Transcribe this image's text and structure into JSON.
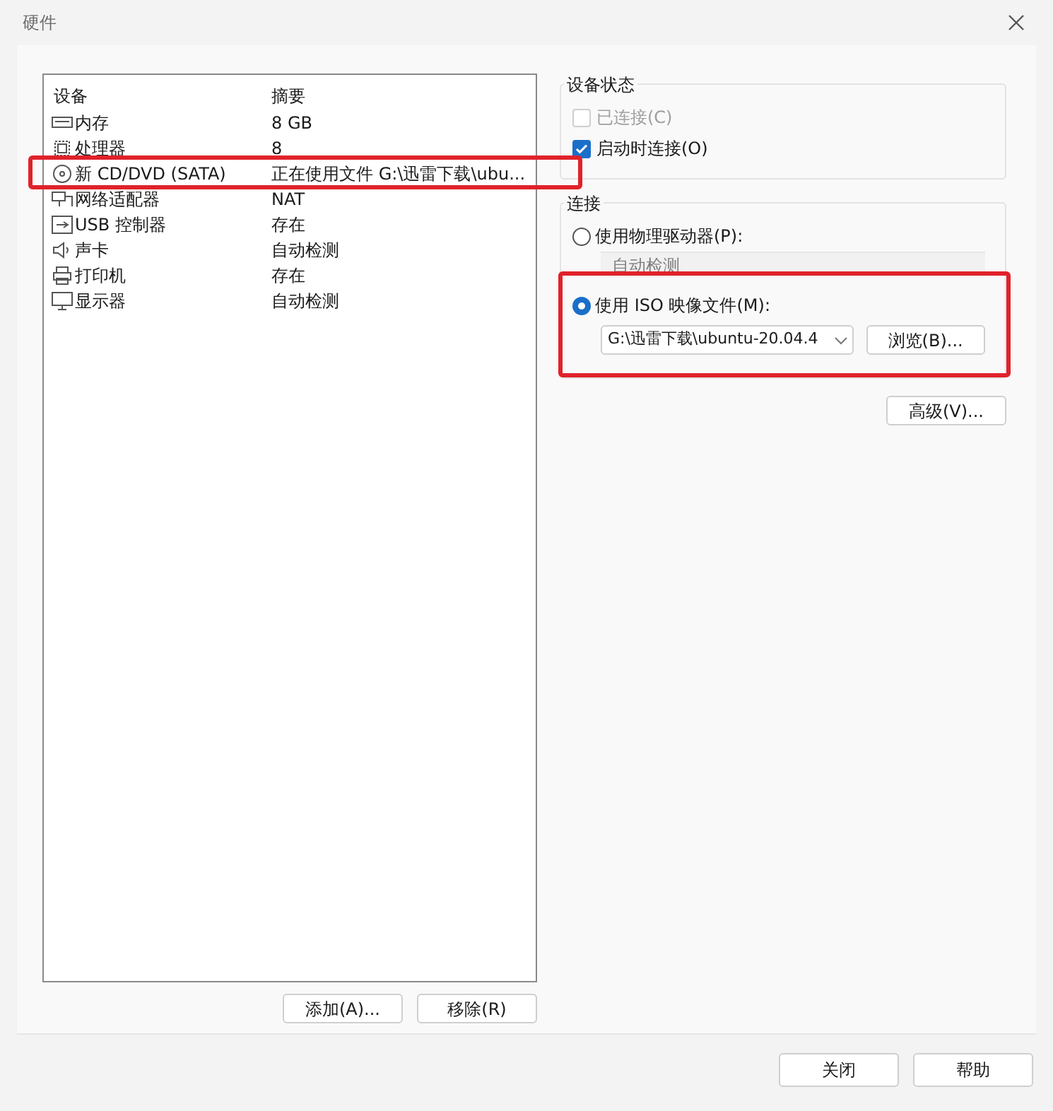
{
  "window": {
    "title": "硬件"
  },
  "device_table": {
    "columns": [
      "设备",
      "摘要"
    ],
    "rows": [
      {
        "device": "内存",
        "summary": "8 GB"
      },
      {
        "device": "处理器",
        "summary": "8"
      },
      {
        "device": "新 CD/DVD (SATA)",
        "summary": "正在使用文件 G:\\迅雷下载\\ubu..."
      },
      {
        "device": "网络适配器",
        "summary": "NAT"
      },
      {
        "device": "USB 控制器",
        "summary": "存在"
      },
      {
        "device": "声卡",
        "summary": "自动检测"
      },
      {
        "device": "打印机",
        "summary": "存在"
      },
      {
        "device": "显示器",
        "summary": "自动检测"
      }
    ]
  },
  "list_buttons": [
    "添加(A)...",
    "移除(R)"
  ],
  "device_status": {
    "title": "设备状态",
    "options": [
      {
        "label": "已连接(C)",
        "checked": false,
        "disabled": true
      },
      {
        "label": "启动时连接(O)",
        "checked": true,
        "disabled": false
      }
    ]
  },
  "connection": {
    "title": "连接",
    "physical": {
      "label": "使用物理驱动器(P):",
      "selected": false,
      "drive": "自动检测"
    },
    "iso": {
      "label": "使用 ISO 映像文件(M):",
      "selected": true,
      "path": "G:\\迅雷下载\\ubuntu-20.04.4",
      "browse": "浏览(B)..."
    }
  },
  "advanced_button": "高级(V)...",
  "footer_buttons": [
    "关闭",
    "帮助"
  ]
}
